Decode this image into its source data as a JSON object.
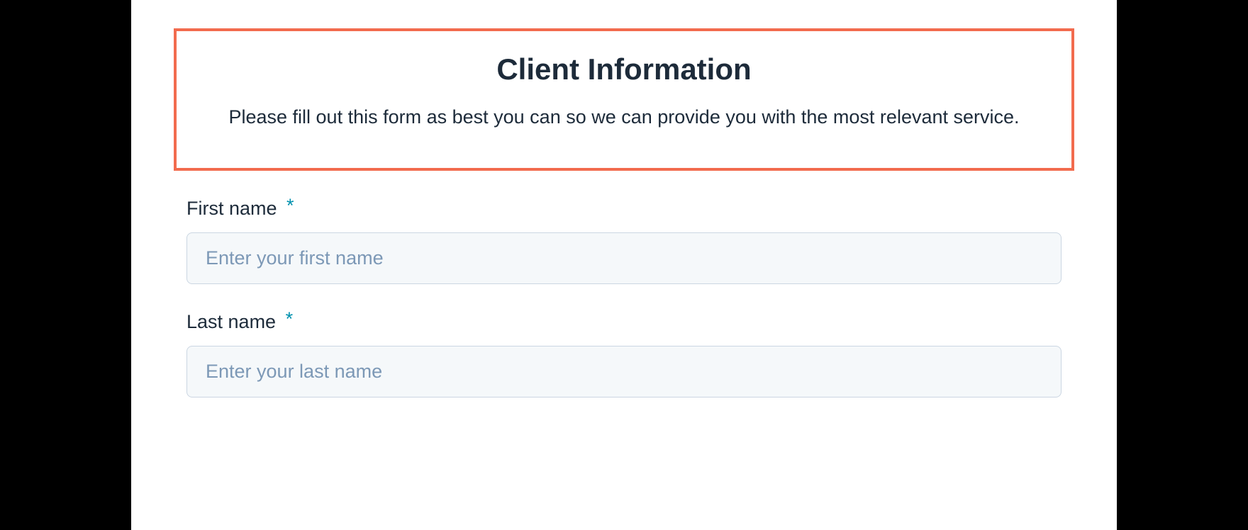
{
  "header": {
    "title": "Client Information",
    "description": "Please fill out this form as best you can so we can provide you with the most relevant service."
  },
  "fields": {
    "first_name": {
      "label": "First name",
      "required_marker": "*",
      "placeholder": "Enter your first name",
      "value": ""
    },
    "last_name": {
      "label": "Last name",
      "required_marker": "*",
      "placeholder": "Enter your last name",
      "value": ""
    }
  }
}
